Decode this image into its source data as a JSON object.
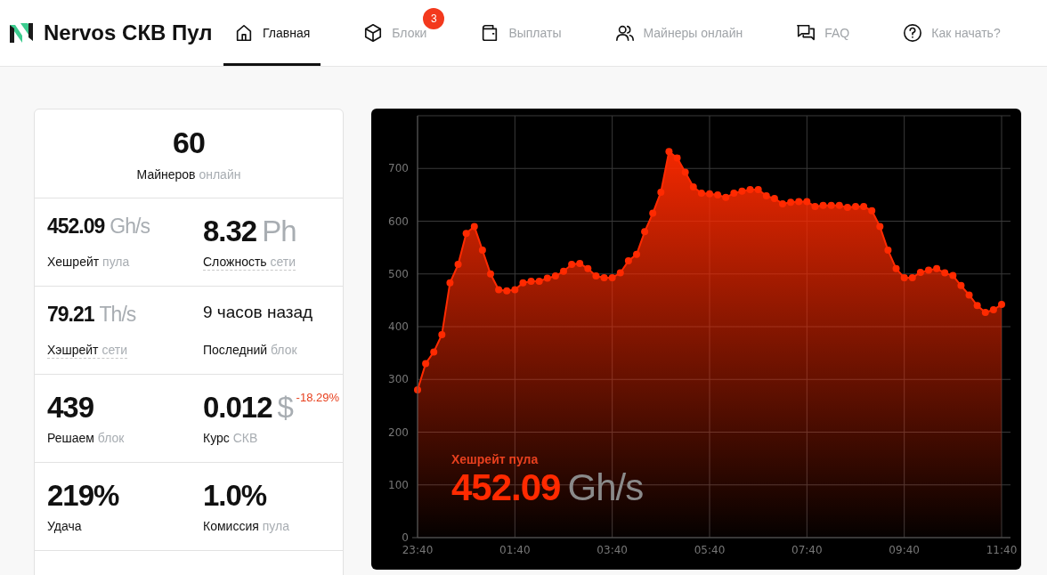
{
  "header": {
    "title": "Nervos СКВ Пул"
  },
  "nav": [
    {
      "label": "Главная",
      "selected": true
    },
    {
      "label": "Блоки",
      "selected": false,
      "badge": "3"
    },
    {
      "label": "Выплаты",
      "selected": false
    },
    {
      "label": "Майнеры онлайн",
      "selected": false
    },
    {
      "label": "FAQ",
      "selected": false
    },
    {
      "label": "Как начать?",
      "selected": false
    }
  ],
  "stats": {
    "headline": {
      "value": "60",
      "label": "Майнеров",
      "label_muted": "онлайн"
    },
    "cells": [
      {
        "kind": "medium",
        "value": "452.09",
        "unit": "Gh/s",
        "label": "Хешрейт",
        "label_muted": "пула",
        "underlined": false
      },
      {
        "kind": "big",
        "value": "8.32",
        "unit": "Ph",
        "label": "Сложность",
        "label_muted": "сети",
        "underlined": true
      },
      {
        "kind": "medium",
        "value": "79.21",
        "unit": "Th/s",
        "label": "Хэшрейт",
        "label_muted": "сети",
        "underlined": true
      },
      {
        "kind": "text",
        "value": "9 часов назад",
        "label": "Последний",
        "label_muted": "блок",
        "underlined": false
      },
      {
        "kind": "big",
        "value": "439",
        "label": "Решаем",
        "label_muted": "блок",
        "underlined": false
      },
      {
        "kind": "big",
        "value": "0.012",
        "unit": "$",
        "label": "Курс",
        "label_muted": "СКВ",
        "underlined": false,
        "change": "-18.29%"
      },
      {
        "kind": "big",
        "value": "219%",
        "label": "Удача",
        "underlined": false
      },
      {
        "kind": "big",
        "value": "1.0%",
        "label": "Комиссия",
        "label_muted": "пула",
        "underlined": false
      }
    ]
  },
  "chart": {
    "overlay_value": "452.09",
    "overlay_unit": "Gh/s",
    "chart_data": {
      "type": "area",
      "categories": [
        "23:40",
        null,
        null,
        null,
        null,
        null,
        null,
        null,
        null,
        null,
        null,
        null,
        "01:40",
        null,
        null,
        null,
        null,
        null,
        null,
        null,
        null,
        null,
        null,
        null,
        "03:40",
        null,
        null,
        null,
        null,
        null,
        null,
        null,
        null,
        null,
        null,
        null,
        "05:40",
        null,
        null,
        null,
        null,
        null,
        null,
        null,
        null,
        null,
        null,
        null,
        "07:40",
        null,
        null,
        null,
        null,
        null,
        null,
        null,
        null,
        null,
        null,
        null,
        "09:40",
        null,
        null,
        null,
        null,
        null,
        null,
        null,
        null,
        null,
        null,
        null,
        "11:40"
      ],
      "series": [
        {
          "name": "Хешрейт пула",
          "color": "#ff2a00",
          "values": [
            280,
            330,
            352,
            385,
            483,
            518,
            577,
            590,
            545,
            500,
            470,
            468,
            470,
            483,
            486,
            486,
            492,
            496,
            505,
            518,
            520,
            510,
            496,
            493,
            493,
            502,
            525,
            537,
            580,
            615,
            655,
            732,
            720,
            693,
            665,
            653,
            652,
            650,
            645,
            653,
            657,
            660,
            660,
            648,
            643,
            633,
            636,
            637,
            637,
            628,
            630,
            630,
            630,
            626,
            628,
            628,
            620,
            590,
            545,
            510,
            493,
            493,
            503,
            507,
            510,
            502,
            497,
            478,
            460,
            440,
            427,
            432,
            442
          ]
        }
      ],
      "ylim": [
        0,
        800
      ],
      "grid": true,
      "yticks": [
        0,
        100,
        200,
        300,
        400,
        500,
        600,
        700
      ]
    }
  }
}
